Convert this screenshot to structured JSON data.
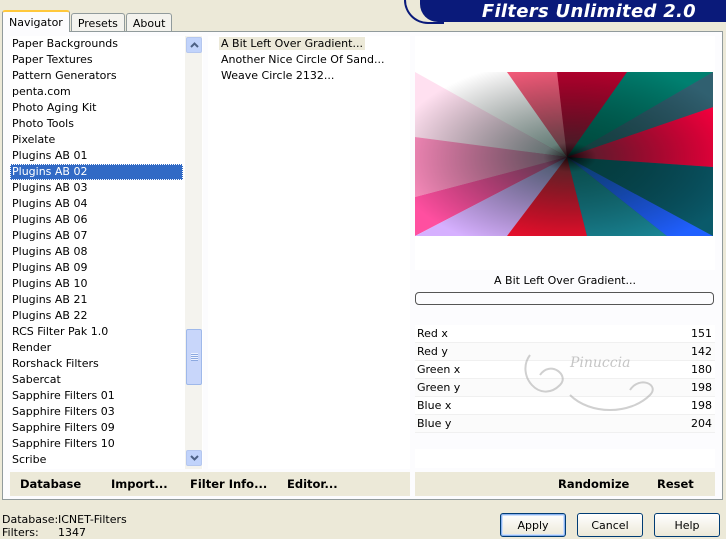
{
  "app": {
    "title": "Filters Unlimited 2.0"
  },
  "tabs": [
    {
      "label": "Navigator",
      "active": true
    },
    {
      "label": "Presets",
      "active": false
    },
    {
      "label": "About",
      "active": false
    }
  ],
  "categories": {
    "selected_index": 8,
    "items": [
      "Paper Backgrounds",
      "Paper Textures",
      "Pattern Generators",
      "penta.com",
      "Photo Aging Kit",
      "Photo Tools",
      "Pixelate",
      "Plugins AB 01",
      "Plugins AB 02",
      "Plugins AB 03",
      "Plugins AB 04",
      "Plugins AB 06",
      "Plugins AB 07",
      "Plugins AB 08",
      "Plugins AB 09",
      "Plugins AB 10",
      "Plugins AB 21",
      "Plugins AB 22",
      "RCS Filter Pak 1.0",
      "Render",
      "Rorshack Filters",
      "Sabercat",
      "Sapphire Filters 01",
      "Sapphire Filters 03",
      "Sapphire Filters 09",
      "Sapphire Filters 10",
      "Scribe"
    ]
  },
  "filters": {
    "selected_index": 0,
    "items": [
      "A Bit Left Over Gradient...",
      "Another Nice Circle Of Sand...",
      "Weave Circle 2132..."
    ]
  },
  "preview": {
    "label": "A Bit Left Over Gradient...",
    "progress": 0
  },
  "params": [
    {
      "name": "Red x",
      "value": "151"
    },
    {
      "name": "Red y",
      "value": "142"
    },
    {
      "name": "Green x",
      "value": "180"
    },
    {
      "name": "Green y",
      "value": "198"
    },
    {
      "name": "Blue x",
      "value": "198"
    },
    {
      "name": "Blue y",
      "value": "204"
    }
  ],
  "watermark": {
    "text": "Pinuccia"
  },
  "toolbar_left": {
    "database": "Database",
    "import": "Import...",
    "filter_info": "Filter Info...",
    "editor": "Editor..."
  },
  "toolbar_right": {
    "randomize": "Randomize",
    "reset": "Reset"
  },
  "status": {
    "database_label": "Database:",
    "database_value": "ICNET-Filters",
    "filters_label": "Filters:",
    "filters_value": "1347"
  },
  "buttons": {
    "apply": "Apply",
    "cancel": "Cancel",
    "help": "Help"
  },
  "colors": {
    "banner": "#0a1a7a",
    "selection": "#316ac5",
    "tab_highlight": "#ffc83c",
    "face": "#ece9d8"
  }
}
